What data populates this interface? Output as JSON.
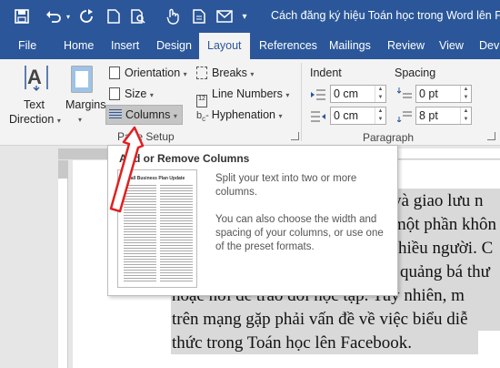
{
  "window": {
    "title": "Cách đăng ký hiệu Toán học trong Word lên Fac"
  },
  "quick_access": [
    "save-icon",
    "undo-icon",
    "redo-icon",
    "file-icon",
    "print-preview-icon",
    "touch-mode-icon",
    "new-doc-icon",
    "email-icon"
  ],
  "tabs": [
    "File",
    "Home",
    "Insert",
    "Design",
    "Layout",
    "References",
    "Mailings",
    "Review",
    "View",
    "Dev"
  ],
  "ribbon": {
    "text_direction": {
      "line1": "Text",
      "line2": "Direction"
    },
    "margins": "Margins",
    "orientation": "Orientation",
    "size": "Size",
    "columns": "Columns",
    "breaks": "Breaks",
    "line_numbers": "Line Numbers",
    "hyphenation": "Hyphenation",
    "page_setup_group": "Page Setup",
    "indent_label": "Indent",
    "spacing_label": "Spacing",
    "indent_left": "0 cm",
    "indent_right": "0 cm",
    "spacing_before": "0 pt",
    "spacing_after": "8 pt",
    "paragraph_group": "Paragraph"
  },
  "tooltip": {
    "title": "Add or Remove Columns",
    "p1": "Split your text into two or more columns.",
    "p2": "You can also choose the width and spacing of your columns, or use one of the preset formats.",
    "thumb_title": "Small Business Plan Update"
  },
  "document": {
    "lines": [
      "ĩ và giao lưu n",
      "một phần khôn",
      "hiều người. C",
      "quảng bá thư",
      "hoặc nơi để trao đổi học tập. Tuy nhiên, m",
      "trên mạng gặp phải vấn đề về việc biểu diễ",
      "thức trong Toán học lên Facebook."
    ]
  },
  "colors": {
    "brand": "#2b579a",
    "ribbon": "#f3f3f3",
    "selection": "#d9d9d9",
    "arrow": "#e02020"
  }
}
